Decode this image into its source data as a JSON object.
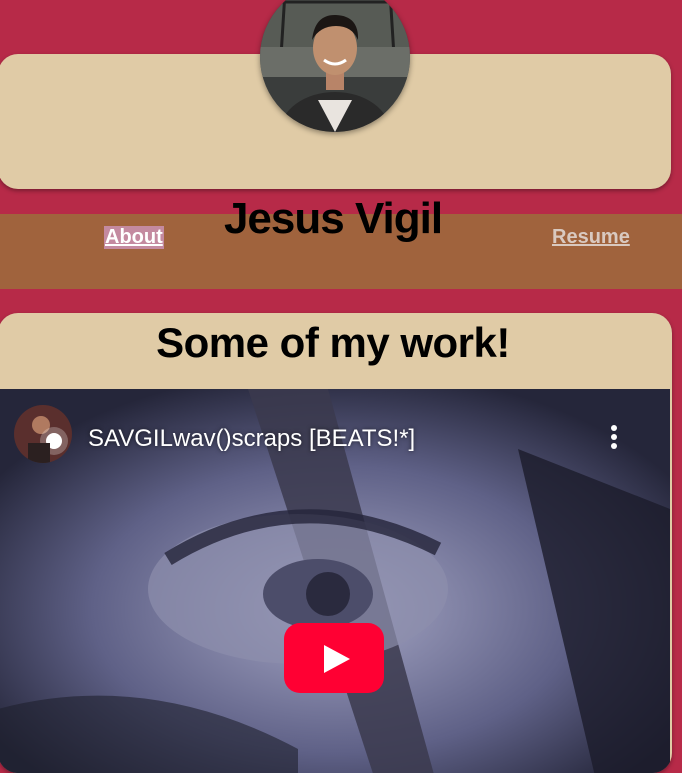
{
  "header": {
    "name": "Jesus Vigil"
  },
  "nav": {
    "about": "About",
    "resume": "Resume"
  },
  "work": {
    "title": "Some of my work!",
    "video": {
      "title": "SAVGILwav()scraps [BEATS!*]"
    }
  },
  "colors": {
    "page_bg": "#b72a48",
    "card_bg": "#e0cba6",
    "nav_bg": "#a0633d",
    "youtube_red": "#ff0033"
  },
  "icons": [
    "profile-photo",
    "channel-avatar-icon",
    "more-options-icon",
    "play-icon"
  ]
}
